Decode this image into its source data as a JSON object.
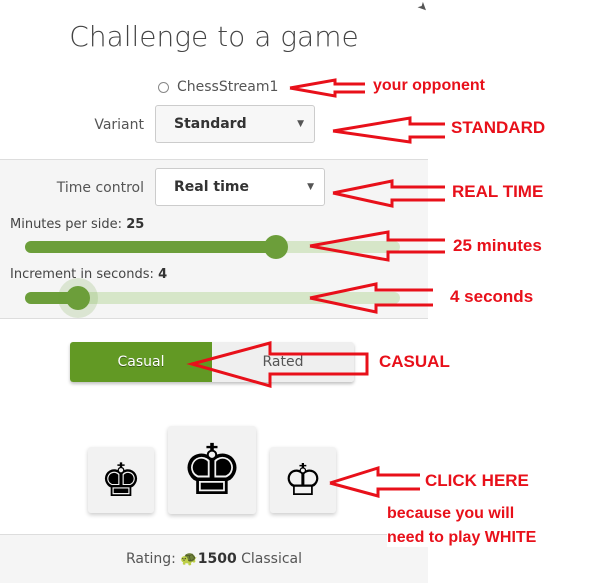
{
  "dialog": {
    "title": "Challenge to a game",
    "opponent": "ChessStream1",
    "variant": {
      "label": "Variant",
      "value": "Standard"
    },
    "time_control": {
      "label": "Time control",
      "value": "Real time"
    },
    "minutes": {
      "label": "Minutes per side:",
      "value": "25",
      "fraction": 0.67
    },
    "increment": {
      "label": "Increment in seconds:",
      "value": "4",
      "fraction": 0.14
    },
    "mode": {
      "casual": "Casual",
      "rated": "Rated",
      "selected": "casual"
    },
    "colors": [
      {
        "name": "black",
        "glyph": "♚"
      },
      {
        "name": "random",
        "glyph": "♚"
      },
      {
        "name": "white",
        "glyph": "♔"
      }
    ],
    "rating": {
      "label": "Rating:",
      "value": "1500",
      "category": "Classical",
      "icon": "turtle-icon"
    }
  },
  "annotations": {
    "opponent": "your opponent",
    "variant": "STANDARD",
    "time": "REAL TIME",
    "minutes": "25 minutes",
    "increment": "4 seconds",
    "mode": "CASUAL",
    "click": "CLICK HERE",
    "reason1": "because you will",
    "reason2": "need to play WHITE",
    "color": "#e8101a"
  }
}
